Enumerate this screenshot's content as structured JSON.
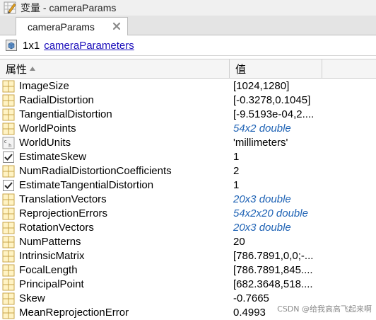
{
  "window": {
    "title": "变量 - cameraParams"
  },
  "tabs": [
    {
      "label": "cameraParams"
    }
  ],
  "info": {
    "size": "1x1",
    "class_link": "cameraParameters"
  },
  "table": {
    "headers": {
      "property": "属性",
      "value": "值"
    },
    "rows": [
      {
        "icon": "matrix-icon",
        "name": "ImageSize",
        "value": "[1024,1280]",
        "italic": false
      },
      {
        "icon": "matrix-icon",
        "name": "RadialDistortion",
        "value": "[-0.3278,0.1045]",
        "italic": false
      },
      {
        "icon": "matrix-icon",
        "name": "TangentialDistortion",
        "value": "[-9.5193e-04,2....",
        "italic": false
      },
      {
        "icon": "matrix-icon",
        "name": "WorldPoints",
        "value": "54x2 double",
        "italic": true
      },
      {
        "icon": "char-icon",
        "name": "WorldUnits",
        "value": "'millimeters'",
        "italic": false
      },
      {
        "icon": "checkbox-icon",
        "name": "EstimateSkew",
        "value": "1",
        "italic": false
      },
      {
        "icon": "matrix-icon",
        "name": "NumRadialDistortionCoefficients",
        "value": "2",
        "italic": false
      },
      {
        "icon": "checkbox-icon",
        "name": "EstimateTangentialDistortion",
        "value": "1",
        "italic": false
      },
      {
        "icon": "matrix-icon",
        "name": "TranslationVectors",
        "value": "20x3 double",
        "italic": true
      },
      {
        "icon": "matrix-icon",
        "name": "ReprojectionErrors",
        "value": "54x2x20 double",
        "italic": true
      },
      {
        "icon": "matrix-icon",
        "name": "RotationVectors",
        "value": "20x3 double",
        "italic": true
      },
      {
        "icon": "matrix-icon",
        "name": "NumPatterns",
        "value": "20",
        "italic": false
      },
      {
        "icon": "matrix-icon",
        "name": "IntrinsicMatrix",
        "value": "[786.7891,0,0;-...",
        "italic": false
      },
      {
        "icon": "matrix-icon",
        "name": "FocalLength",
        "value": "[786.7891,845....",
        "italic": false
      },
      {
        "icon": "matrix-icon",
        "name": "PrincipalPoint",
        "value": "[682.3648,518....",
        "italic": false
      },
      {
        "icon": "matrix-icon",
        "name": "Skew",
        "value": "-0.7665",
        "italic": false
      },
      {
        "icon": "matrix-icon",
        "name": "MeanReprojectionError",
        "value": "0.4993",
        "italic": false
      }
    ]
  },
  "watermark": "CSDN @给我高高飞起来啊",
  "colors": {
    "link": "#1a0dbb",
    "italic_value": "#1f63b5",
    "icon_border": "#c9a64a",
    "icon_fill": "#fff3c4"
  }
}
